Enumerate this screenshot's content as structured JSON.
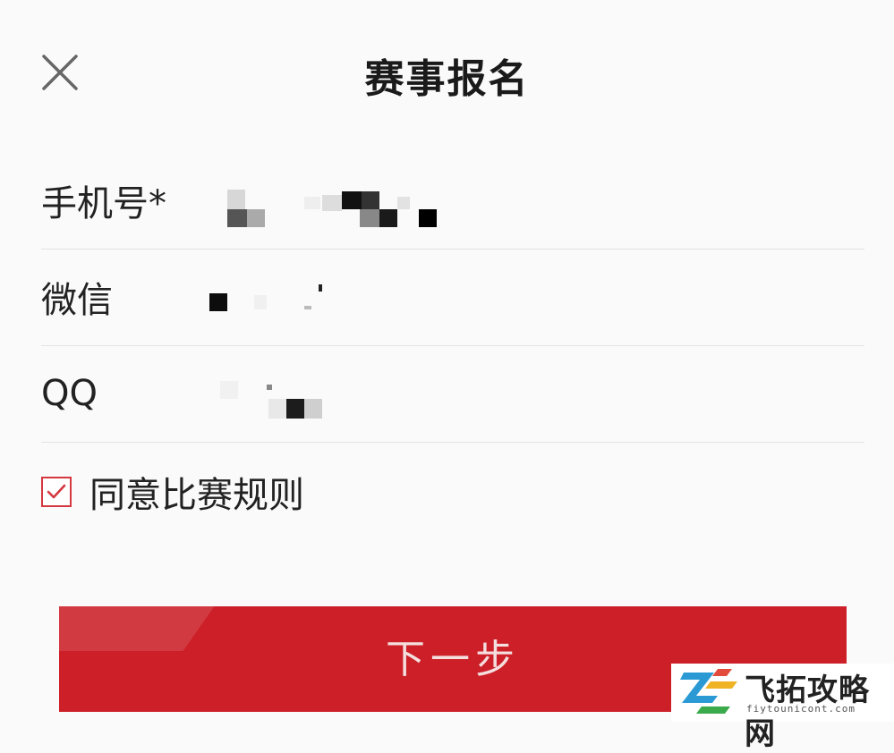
{
  "header": {
    "title": "赛事报名",
    "close_icon": "close-icon"
  },
  "form": {
    "fields": [
      {
        "label": "手机号*",
        "value": "[pixelated]"
      },
      {
        "label": "微信",
        "value": "[pixelated]"
      },
      {
        "label": "QQ",
        "value": "[pixelated]"
      }
    ],
    "agree": {
      "checked": true,
      "label": "同意比赛规则",
      "icon": "checkbox-checked-icon"
    },
    "submit_label": "下一步"
  },
  "watermark": {
    "name": "飞拓攻略网",
    "url": "fiytounicont.com"
  },
  "colors": {
    "accent": "#cc1f28",
    "checkbox": "#d4373f",
    "divider": "#e3e3e3"
  }
}
